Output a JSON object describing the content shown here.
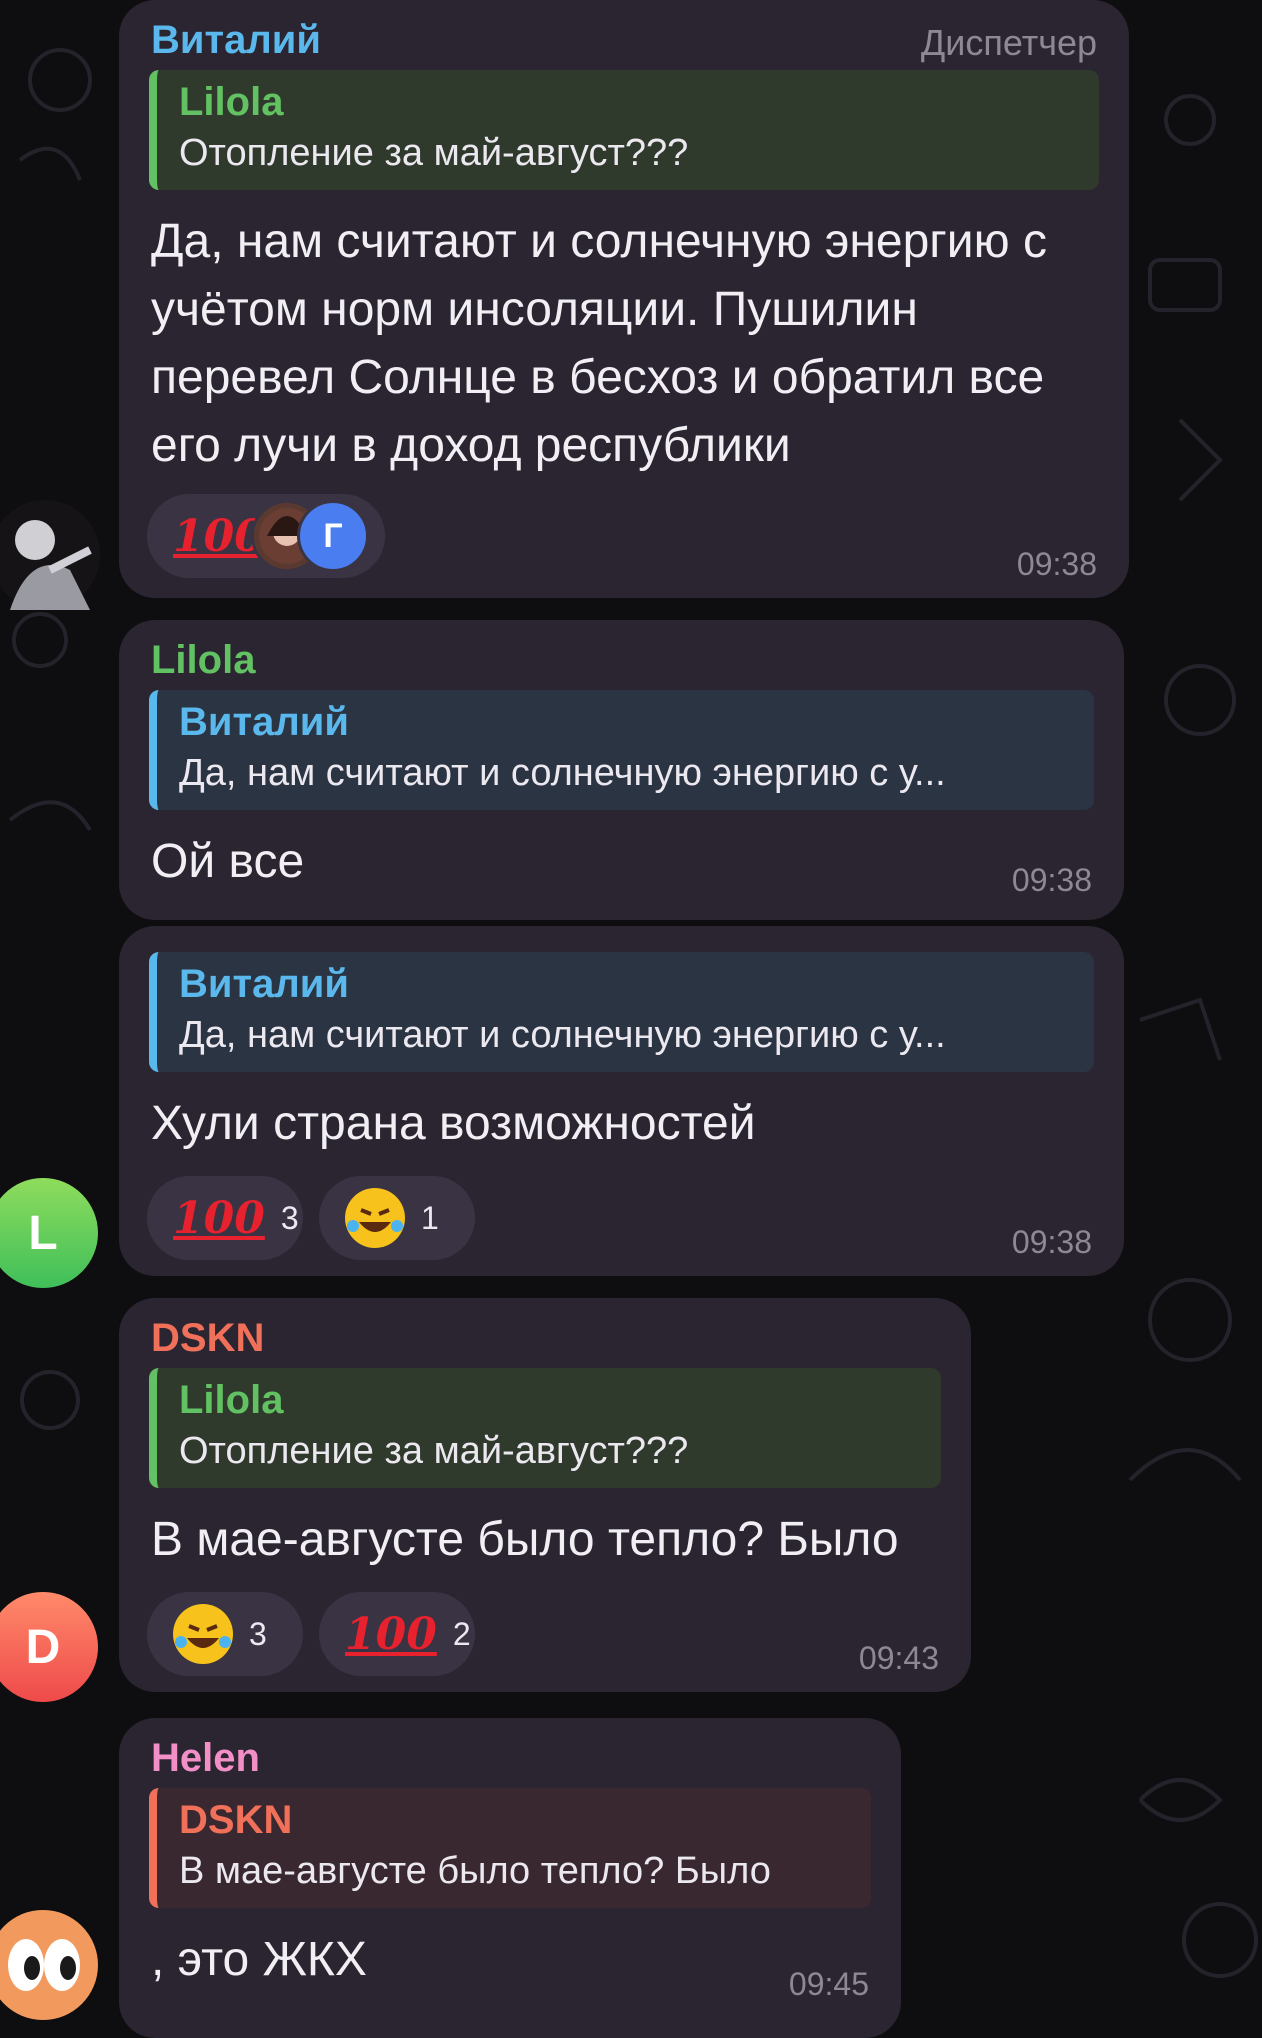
{
  "colors": {
    "background": "#0e0e10",
    "bubble": "#2a2530",
    "sender_blue": "#5bb8ec",
    "sender_green": "#62c162",
    "sender_red": "#f0705a",
    "sender_pink": "#f28fc7",
    "time": "#8e8896"
  },
  "messages": [
    {
      "sender": "Виталий",
      "role": "Диспетчер",
      "reply_to": {
        "name": "Lilola",
        "text": "Отопление за май-август???"
      },
      "text": "Да, нам считают и солнечную энергию с учётом норм инсоляции. Пушилин перевел Солнце в бесхоз и обратил все его лучи в доход республики",
      "reaction": {
        "emoji": "100-icon",
        "reactor_initial": "Г"
      },
      "time": "09:38"
    },
    {
      "sender": "Lilola",
      "reply_to": {
        "name": "Виталий",
        "text": "Да, нам считают и солнечную энергию с у..."
      },
      "text": "Ой все",
      "time": "09:38"
    },
    {
      "reply_to": {
        "name": "Виталий",
        "text": "Да, нам считают и солнечную энергию с у..."
      },
      "text": "Хули страна возможностей",
      "reactions": [
        {
          "emoji": "100-icon",
          "count": "3"
        },
        {
          "emoji": "rofl-emoji-icon",
          "count": "1"
        }
      ],
      "time": "09:38",
      "avatar_initial": "L"
    },
    {
      "sender": "DSKN",
      "reply_to": {
        "name": "Lilola",
        "text": "Отопление за май-август???"
      },
      "text": "В мае-августе было тепло? Было",
      "reactions": [
        {
          "emoji": "rofl-emoji-icon",
          "count": "3"
        },
        {
          "emoji": "100-icon",
          "count": "2"
        }
      ],
      "time": "09:43",
      "avatar_initial": "D"
    },
    {
      "sender": "Helen",
      "reply_to": {
        "name": "DSKN",
        "text": "В мае-августе было тепло? Было"
      },
      "text": ", это ЖКХ",
      "time": "09:45"
    }
  ]
}
